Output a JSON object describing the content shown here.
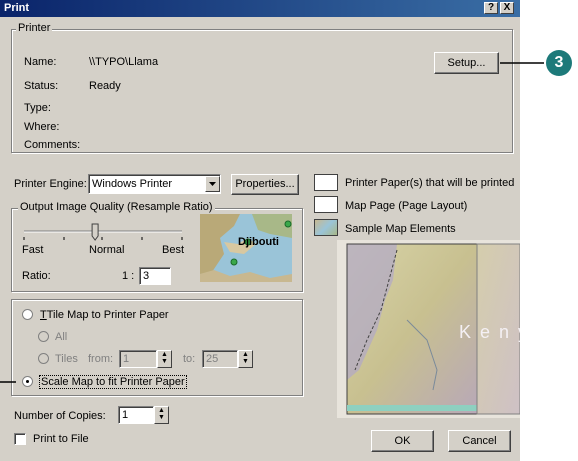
{
  "window": {
    "title": "Print",
    "help_label": "?",
    "close_label": "X"
  },
  "printer": {
    "group_label": "Printer",
    "name_label": "Name:",
    "name_value": "\\\\TYPO\\Llama",
    "status_label": "Status:",
    "status_value": "Ready",
    "type_label": "Type:",
    "where_label": "Where:",
    "comments_label": "Comments:",
    "setup_label": "Setup..."
  },
  "engine": {
    "label": "Printer Engine:",
    "selected": "Windows Printer",
    "properties_label": "Properties..."
  },
  "quality": {
    "group_label": "Output Image Quality (Resample Ratio)",
    "fast": "Fast",
    "normal": "Normal",
    "best": "Best",
    "ratio_label": "Ratio:",
    "ratio_prefix": "1 :",
    "ratio_value": "3",
    "slider_level": 0.45,
    "preview_text": "Djibouti"
  },
  "legend": {
    "printer_paper": "Printer Paper(s) that will be printed",
    "map_page": "Map Page (Page Layout)",
    "sample_elements": "Sample Map Elements"
  },
  "preview": {
    "map_text": "K e n y"
  },
  "tiling": {
    "tile_label": "Tile Map to Printer Paper",
    "all_label": "All",
    "tiles_label": "Tiles",
    "from_label": "from:",
    "from_value": "1",
    "to_label": "to:",
    "to_value": "25",
    "scale_label": "Scale Map to fit Printer Paper"
  },
  "copies": {
    "label": "Number of Copies:",
    "value": "1"
  },
  "print_to_file": {
    "label": "Print to File"
  },
  "buttons": {
    "ok": "OK",
    "cancel": "Cancel"
  },
  "callout": {
    "number": "3"
  },
  "colors": {
    "title_start": "#0a246a",
    "title_end": "#3a6ea5",
    "callout": "#1d7a7a",
    "dialog": "#d4d0c8"
  }
}
